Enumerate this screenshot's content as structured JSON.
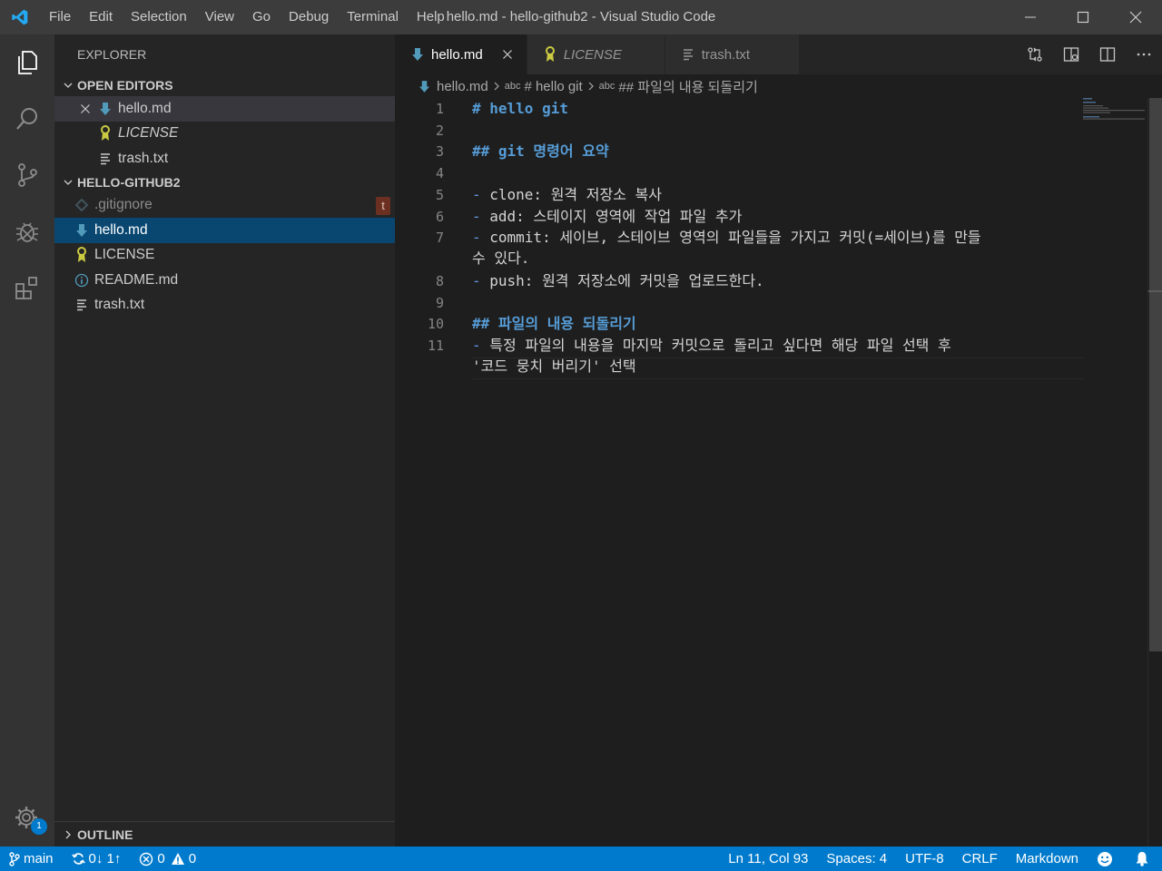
{
  "window": {
    "title": "hello.md - hello-github2 - Visual Studio Code",
    "menu": [
      "File",
      "Edit",
      "Selection",
      "View",
      "Go",
      "Debug",
      "Terminal",
      "Help"
    ]
  },
  "activity_bar": {
    "items": [
      "files-icon",
      "search-icon",
      "source-control-icon",
      "debug-icon",
      "extensions-icon"
    ],
    "settings_badge": "1"
  },
  "sidebar": {
    "title": "EXPLORER",
    "open_editors": {
      "header": "OPEN EDITORS",
      "items": [
        {
          "name": "hello.md",
          "icon": "markdown-icon"
        },
        {
          "name": "LICENSE",
          "icon": "license-icon",
          "style": "italic"
        },
        {
          "name": "trash.txt",
          "icon": "text-file-icon"
        }
      ]
    },
    "folder": {
      "header": "HELLO-GITHUB2",
      "items": [
        {
          "name": ".gitignore",
          "icon": "gitignore-icon",
          "decoration": "t"
        },
        {
          "name": "hello.md",
          "icon": "markdown-icon",
          "selected": true
        },
        {
          "name": "LICENSE",
          "icon": "license-icon"
        },
        {
          "name": "README.md",
          "icon": "info-icon"
        },
        {
          "name": "trash.txt",
          "icon": "text-file-icon"
        }
      ]
    },
    "outline_header": "OUTLINE"
  },
  "editor": {
    "tabs": [
      {
        "label": "hello.md",
        "icon": "markdown-icon",
        "active": true
      },
      {
        "label": "LICENSE",
        "icon": "license-icon",
        "italic": true
      },
      {
        "label": "trash.txt",
        "icon": "text-file-icon"
      }
    ],
    "breadcrumbs": {
      "file": "hello.md",
      "abc1": "abc",
      "symbol1": "# hello git",
      "abc2": "abc",
      "symbol2": "## 파일의 내용 되돌리기"
    },
    "lines": [
      {
        "n": "1",
        "text": "# hello git"
      },
      {
        "n": "2",
        "text": ""
      },
      {
        "n": "3",
        "text": "## git 명령어 요약"
      },
      {
        "n": "4",
        "text": ""
      },
      {
        "n": "5",
        "text": "clone: 원격 저장소 복사"
      },
      {
        "n": "6",
        "text": "add: 스테이지 영역에 작업 파일 추가"
      },
      {
        "n": "7",
        "text": "commit: 세이브, 스테이브 영역의 파일들을 가지고 커밋(=세이브)를 만들",
        "wrap": "수 있다."
      },
      {
        "n": "8",
        "text": "push: 원격 저장소에 커밋을 업로드한다."
      },
      {
        "n": "9",
        "text": ""
      },
      {
        "n": "10",
        "text": "## 파일의 내용 되돌리기"
      },
      {
        "n": "11",
        "text": "특정 파일의 내용을 마지막 커밋으로 돌리고 싶다면 해당 파일 선택 후",
        "wrap": "'코드 뭉치 버리기' 선택"
      }
    ]
  },
  "status_bar": {
    "branch": "main",
    "sync": "0↓ 1↑",
    "errors": "0",
    "warnings": "0",
    "position": "Ln 11, Col 93",
    "spaces": "Spaces: 4",
    "encoding": "UTF-8",
    "eol": "CRLF",
    "language": "Markdown"
  },
  "colors": {
    "accent": "#007acc",
    "selection": "#094771",
    "heading": "#569cd6",
    "markdown_icon": "#519aba",
    "license_icon": "#cbcb41"
  }
}
